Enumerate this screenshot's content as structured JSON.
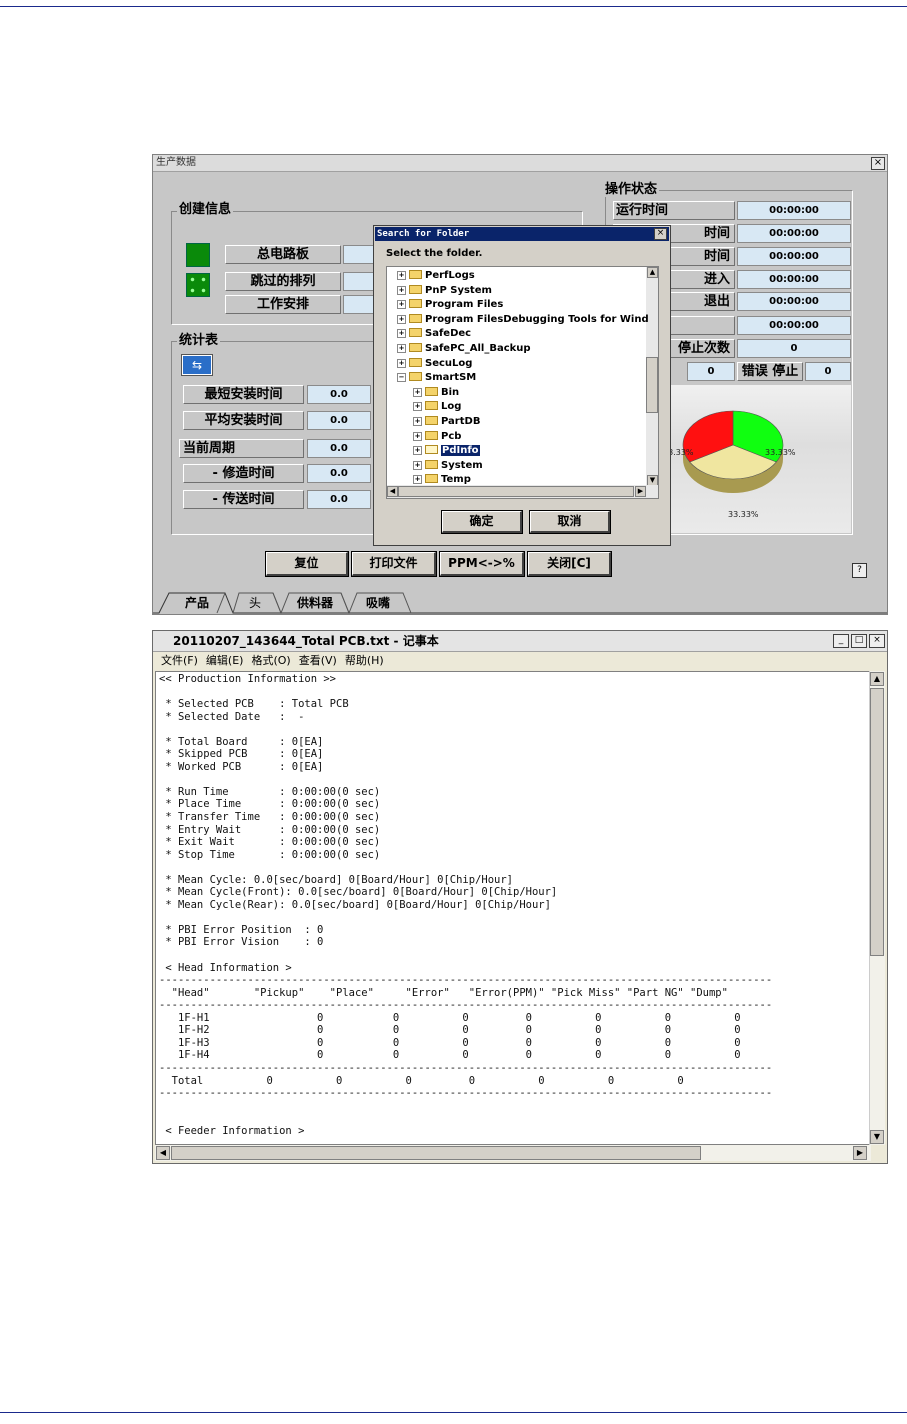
{
  "production": {
    "title": "生产数据",
    "close_glyph": "×",
    "create_info": {
      "legend": "创建信息",
      "rows": [
        {
          "label": "总电路板"
        },
        {
          "label": "跳过的排列"
        },
        {
          "label": "工作安排"
        }
      ]
    },
    "stats": {
      "legend": "统计表",
      "rows": [
        {
          "label": "最短安装时间",
          "value": "0.0"
        },
        {
          "label": "平均安装时间",
          "value": "0.0"
        },
        {
          "label": "当前周期",
          "value": "0.0"
        },
        {
          "label": "- 修造时间",
          "value": "0.0"
        },
        {
          "label": "- 传送时间",
          "value": "0.0"
        }
      ]
    },
    "op_status": {
      "legend": "操作状态",
      "rows": [
        {
          "label": "运行时间",
          "value": "00:00:00"
        },
        {
          "label": "时间",
          "value": "00:00:00"
        },
        {
          "label": "时间",
          "value": "00:00:00"
        },
        {
          "label": "进入",
          "value": "00:00:00"
        },
        {
          "label": "退出",
          "value": "00:00:00"
        },
        {
          "label": "",
          "value": "00:00:00"
        }
      ],
      "stop_count_label": "停止次数",
      "stop_count_value": "0",
      "small_value": "0",
      "error_stop_label": "错误 停止",
      "error_stop_value": "0"
    },
    "chart_data": {
      "type": "pie",
      "values": [
        33.33,
        33.33,
        33.33
      ],
      "labels": [
        "33.33%",
        "33.33%",
        "33.33%"
      ],
      "colors": [
        "#ff1010",
        "#10ff10",
        "#f0e6a0"
      ]
    },
    "buttons": [
      "复位",
      "打印文件",
      "PPM<->%",
      "关闭[C]"
    ],
    "help_glyph": "?",
    "tabs": [
      "产品",
      "头",
      "供料器",
      "吸嘴"
    ]
  },
  "dialog": {
    "title": "Search for Folder",
    "close_glyph": "×",
    "prompt": "Select the folder.",
    "items": [
      {
        "label": "PerfLogs",
        "level": 0,
        "expanded": false,
        "selected": false
      },
      {
        "label": "PnP System",
        "level": 0,
        "expanded": false,
        "selected": false
      },
      {
        "label": "Program Files",
        "level": 0,
        "expanded": false,
        "selected": false
      },
      {
        "label": "Program FilesDebugging Tools for Wind",
        "level": 0,
        "expanded": false,
        "selected": false
      },
      {
        "label": "SafeDec",
        "level": 0,
        "expanded": false,
        "selected": false
      },
      {
        "label": "SafePC_All_Backup",
        "level": 0,
        "expanded": false,
        "selected": false
      },
      {
        "label": "SecuLog",
        "level": 0,
        "expanded": false,
        "selected": false
      },
      {
        "label": "SmartSM",
        "level": 0,
        "expanded": true,
        "selected": false
      },
      {
        "label": "Bin",
        "level": 1,
        "expanded": false,
        "selected": false
      },
      {
        "label": "Log",
        "level": 1,
        "expanded": false,
        "selected": false
      },
      {
        "label": "PartDB",
        "level": 1,
        "expanded": false,
        "selected": false
      },
      {
        "label": "Pcb",
        "level": 1,
        "expanded": false,
        "selected": false
      },
      {
        "label": "PdInfo",
        "level": 1,
        "expanded": false,
        "selected": true
      },
      {
        "label": "System",
        "level": 1,
        "expanded": false,
        "selected": false
      },
      {
        "label": "Temp",
        "level": 1,
        "expanded": false,
        "selected": false
      }
    ],
    "ok_label": "确定",
    "cancel_label": "取消"
  },
  "notepad": {
    "title": "20110207_143644_Total PCB.txt - 记事本",
    "menu": [
      "文件(F)",
      "编辑(E)",
      "格式(O)",
      "查看(V)",
      "帮助(H)"
    ],
    "content": "<< Production Information >>\n\n * Selected PCB    : Total PCB\n * Selected Date   :  -\n\n * Total Board     : 0[EA]\n * Skipped PCB     : 0[EA]\n * Worked PCB      : 0[EA]\n\n * Run Time        : 0:00:00(0 sec)\n * Place Time      : 0:00:00(0 sec)\n * Transfer Time   : 0:00:00(0 sec)\n * Entry Wait      : 0:00:00(0 sec)\n * Exit Wait       : 0:00:00(0 sec)\n * Stop Time       : 0:00:00(0 sec)\n\n * Mean Cycle: 0.0[sec/board] 0[Board/Hour] 0[Chip/Hour]\n * Mean Cycle(Front): 0.0[sec/board] 0[Board/Hour] 0[Chip/Hour]\n * Mean Cycle(Rear): 0.0[sec/board] 0[Board/Hour] 0[Chip/Hour]\n\n * PBI Error Position  : 0\n * PBI Error Vision    : 0\n\n < Head Information >\n-------------------------------------------------------------------------------------------------\n  \"Head\"       \"Pickup\"    \"Place\"     \"Error\"   \"Error(PPM)\" \"Pick Miss\" \"Part NG\" \"Dump\"\n-------------------------------------------------------------------------------------------------\n   1F-H1                 0           0          0         0          0          0          0\n   1F-H2                 0           0          0         0          0          0          0\n   1F-H3                 0           0          0         0          0          0          0\n   1F-H4                 0           0          0         0          0          0          0\n-------------------------------------------------------------------------------------------------\n  Total          0          0          0         0          0          0          0\n-------------------------------------------------------------------------------------------------\n\n\n < Feeder Information >"
  }
}
